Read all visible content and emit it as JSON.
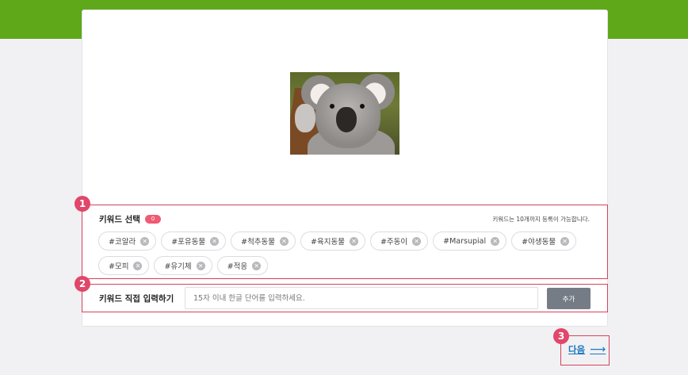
{
  "keyword_section": {
    "title": "키워드 선택",
    "count": "0",
    "note": "키워드는 10개까지 등록이 가능합니다.",
    "keywords": [
      "#코알라",
      "#포유동물",
      "#척추동물",
      "#육지동물",
      "#주동이",
      "#Marsupial",
      "#야생동물",
      "#모피",
      "#유기체",
      "#적응"
    ]
  },
  "direct_input": {
    "label": "키워드 직접 입력하기",
    "placeholder": "15자 이내 한글 단어를 입력하세요.",
    "add_label": "추가"
  },
  "next": {
    "label": "다음",
    "arrow": "⟶"
  },
  "markers": [
    "1",
    "2",
    "3"
  ],
  "colors": {
    "topbar": "#5ea81a",
    "highlight": "#d6415b",
    "marker": "#e0476a",
    "link": "#1a76bf",
    "add_button": "#767c86"
  }
}
